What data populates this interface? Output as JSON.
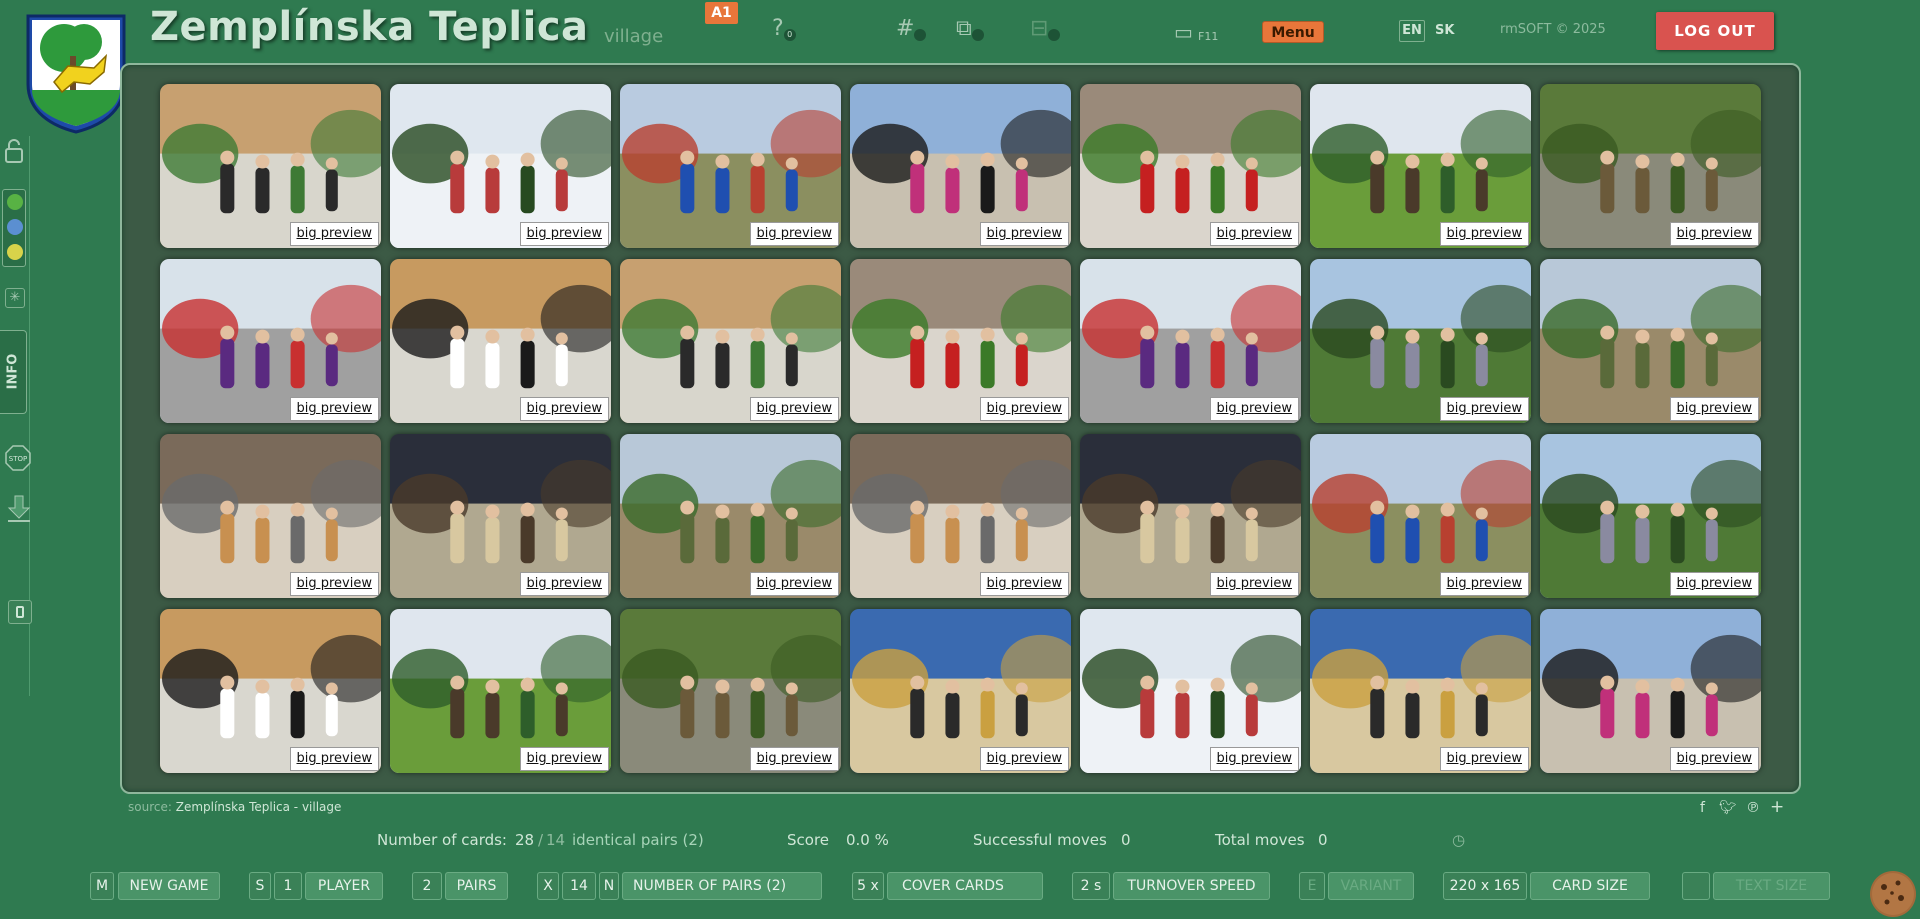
{
  "header": {
    "title": "Zemplínska Teplica",
    "subtitle": "village",
    "level_badge": "A1",
    "icons": [
      {
        "name": "help-icon",
        "glyph": "?",
        "count": "0"
      },
      {
        "name": "hash-icon",
        "glyph": "#",
        "count": ""
      },
      {
        "name": "cards-icon",
        "glyph": "⧉",
        "count": ""
      },
      {
        "name": "camera-icon",
        "glyph": "⊟",
        "count": ""
      }
    ],
    "fullscreen_label": "F11",
    "menu_label": "Menu",
    "lang_en": "EN",
    "lang_sk": "SK",
    "copyright": "rmSOFT © 2025",
    "logout_label": "LOG OUT"
  },
  "rail": {
    "info_label": "INFO",
    "stop_label": "STOP",
    "colors": [
      "#58b244",
      "#5b8fd1",
      "#d8d34a"
    ]
  },
  "board": {
    "preview_label": "big preview",
    "cards": [
      {
        "scene": "stage-kids"
      },
      {
        "scene": "dancers-banner"
      },
      {
        "scene": "firemen-field"
      },
      {
        "scene": "tent-girls"
      },
      {
        "scene": "theater"
      },
      {
        "scene": "horse-field"
      },
      {
        "scene": "forest-camp"
      },
      {
        "scene": "girls-purple"
      },
      {
        "scene": "stage-choir"
      },
      {
        "scene": "stage-kids"
      },
      {
        "scene": "theater"
      },
      {
        "scene": "girls-purple"
      },
      {
        "scene": "group-trees"
      },
      {
        "scene": "soldiers-yard"
      },
      {
        "scene": "pastries"
      },
      {
        "scene": "hall-stage"
      },
      {
        "scene": "soldiers-yard"
      },
      {
        "scene": "pastries"
      },
      {
        "scene": "hall-stage"
      },
      {
        "scene": "firemen-field"
      },
      {
        "scene": "group-trees"
      },
      {
        "scene": "stage-choir"
      },
      {
        "scene": "horse-field"
      },
      {
        "scene": "forest-camp"
      },
      {
        "scene": "priests"
      },
      {
        "scene": "dancers-banner"
      },
      {
        "scene": "priests"
      },
      {
        "scene": "tent-girls"
      }
    ]
  },
  "source": {
    "label": "source:",
    "value": "Zemplínska Teplica - village"
  },
  "stats": {
    "cards_label": "Number of cards:",
    "cards_value": "28",
    "cards_total": "14",
    "pairs_label": "identical pairs (2)",
    "score_label": "Score",
    "score_value": "0.0 %",
    "moves_label": "Successful moves",
    "moves_value": "0",
    "total_label": "Total moves",
    "total_value": "0"
  },
  "toolbar": {
    "new_game_key": "M",
    "new_game": "NEW GAME",
    "player_key": "S",
    "player_value": "1",
    "player": "PLAYER",
    "pairs_value": "2",
    "pairs": "PAIRS",
    "x_key": "X",
    "pairs_count": "14",
    "n_key": "N",
    "number_of_pairs": "NUMBER OF PAIRS (2)",
    "cover_value": "5 x",
    "cover": "COVER CARDS",
    "speed_value": "2 s",
    "speed": "TURNOVER SPEED",
    "variant_key": "E",
    "variant": "VARIANT",
    "size_value": "220 x 165",
    "size": "CARD SIZE",
    "text_size": "TEXT SIZE"
  }
}
